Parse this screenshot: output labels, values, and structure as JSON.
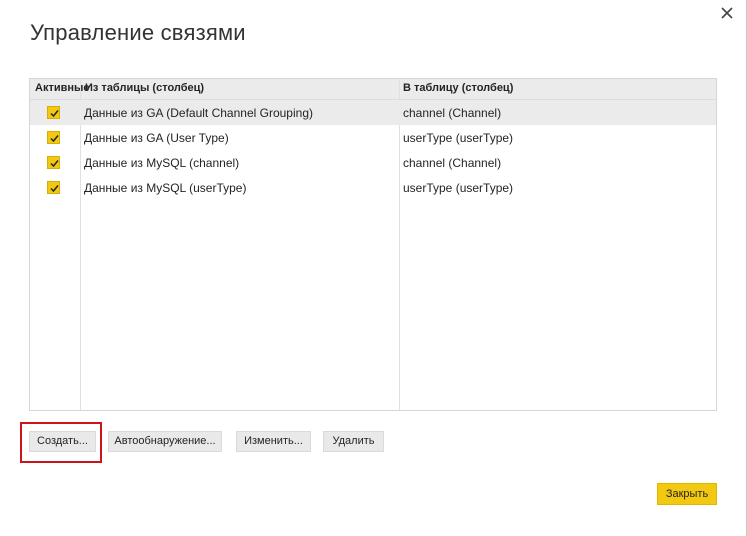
{
  "dialog": {
    "title": "Управление связями",
    "close_icon": "close-icon"
  },
  "table": {
    "columns": {
      "active": "Активные",
      "from": "Из таблицы (столбец)",
      "to": "В таблицу (столбец)"
    },
    "rows": [
      {
        "active": true,
        "from": "Данные из GA (Default Channel Grouping)",
        "to": "channel (Channel)"
      },
      {
        "active": true,
        "from": "Данные из GA (User Type)",
        "to": "userType (userType)"
      },
      {
        "active": true,
        "from": "Данные из MySQL (channel)",
        "to": "channel (Channel)"
      },
      {
        "active": true,
        "from": "Данные из MySQL (userType)",
        "to": "userType (userType)"
      }
    ],
    "selected_row_index": 0
  },
  "actions": {
    "create": "Создать...",
    "autodetect": "Автообнаружение...",
    "edit": "Изменить...",
    "delete": "Удалить",
    "close": "Закрыть"
  },
  "colors": {
    "accent": "#f2c811",
    "highlight": "#d0121b",
    "header_bg": "#ebebeb",
    "button_bg": "#e9e9e9"
  }
}
